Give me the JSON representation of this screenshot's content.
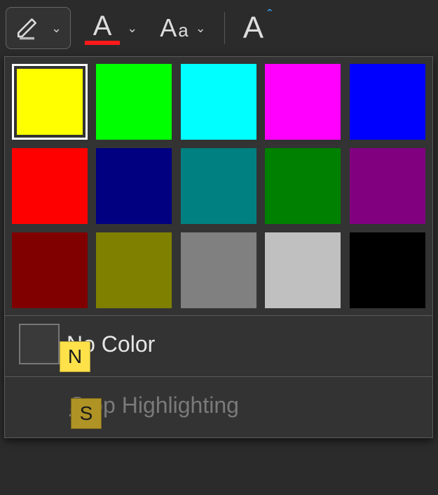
{
  "toolbar": {
    "highlight": {
      "accent": "#cccccc"
    },
    "fontColor": {
      "underline": "#ff1a1a"
    },
    "caseLabelBig": "A",
    "caseLabelSmall": "a",
    "superscriptCaret": "ˆ"
  },
  "dropdown": {
    "swatches": [
      {
        "name": "yellow",
        "hex": "#ffff00",
        "selected": true
      },
      {
        "name": "lime",
        "hex": "#00ff00",
        "selected": false
      },
      {
        "name": "cyan",
        "hex": "#00ffff",
        "selected": false
      },
      {
        "name": "magenta",
        "hex": "#ff00ff",
        "selected": false
      },
      {
        "name": "blue",
        "hex": "#0000ff",
        "selected": false
      },
      {
        "name": "red",
        "hex": "#ff0000",
        "selected": false
      },
      {
        "name": "navy",
        "hex": "#000080",
        "selected": false
      },
      {
        "name": "teal",
        "hex": "#008080",
        "selected": false
      },
      {
        "name": "green",
        "hex": "#008000",
        "selected": false
      },
      {
        "name": "purple",
        "hex": "#800080",
        "selected": false
      },
      {
        "name": "maroon",
        "hex": "#800000",
        "selected": false
      },
      {
        "name": "olive",
        "hex": "#808000",
        "selected": false
      },
      {
        "name": "gray",
        "hex": "#808080",
        "selected": false
      },
      {
        "name": "lightgray",
        "hex": "#c0c0c0",
        "selected": false
      },
      {
        "name": "black",
        "hex": "#000000",
        "selected": false
      }
    ],
    "noColor": {
      "label_pre": "N",
      "label_rest": "o Color",
      "shortcut": "N"
    },
    "stopHighlighting": {
      "label_pre": "S",
      "label_rest": "top Highlighting",
      "shortcut": "S",
      "enabled": false
    }
  }
}
